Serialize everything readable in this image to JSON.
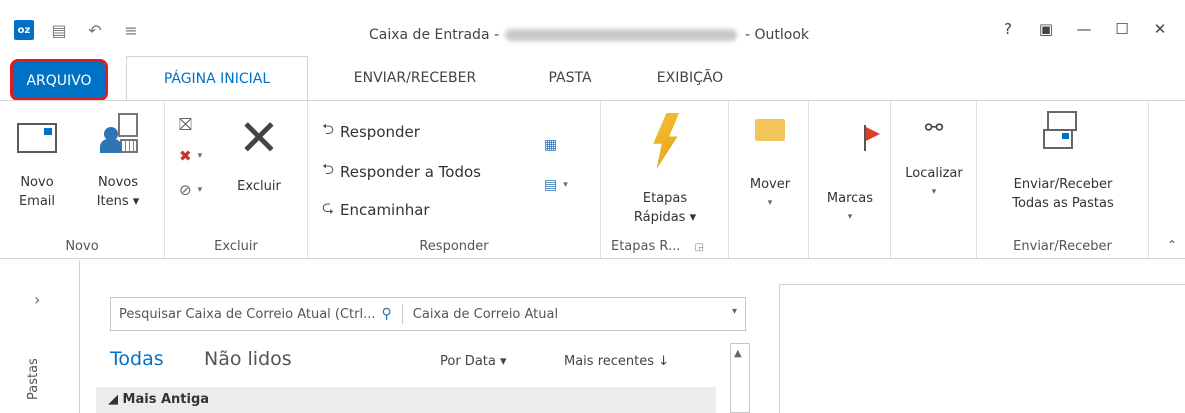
{
  "window": {
    "title_left": "Caixa de Entrada -",
    "title_right": "- Outlook",
    "controls": {
      "help": "?",
      "ribbon_options": "▣",
      "minimize": "—",
      "maximize": "☐",
      "close": "✕"
    },
    "app_icon_text": "oz"
  },
  "tabs": {
    "file": "ARQUIVO",
    "home": "PÁGINA INICIAL",
    "send_receive": "ENVIAR/RECEBER",
    "folder": "PASTA",
    "view": "EXIBIÇÃO"
  },
  "ribbon": {
    "novo": {
      "label": "Novo",
      "new_email": [
        "Novo",
        "Email"
      ],
      "new_items": [
        "Novos",
        "Itens ▾"
      ]
    },
    "excluir": {
      "label": "Excluir",
      "delete": "Excluir"
    },
    "responder": {
      "label": "Responder",
      "reply": "Responder",
      "reply_all": "Responder a Todos",
      "forward": "Encaminhar"
    },
    "etapas": {
      "label": "Etapas R...",
      "quick_steps": [
        "Etapas",
        "Rápidas ▾"
      ]
    },
    "mover": {
      "label": "Mover"
    },
    "marcas": {
      "label": "Marcas"
    },
    "localizar": {
      "label": "Localizar"
    },
    "enviar": {
      "label": "Enviar/Receber",
      "send_all": [
        "Enviar/Receber",
        "Todas as Pastas"
      ]
    }
  },
  "folders_rail": {
    "label": "Pastas"
  },
  "search": {
    "placeholder": "Pesquisar Caixa de Correio Atual (Ctrl...",
    "scope": "Caixa de Correio Atual"
  },
  "filters": {
    "all": "Todas",
    "unread": "Não lidos",
    "by_date": "Por Data ▾",
    "recent": "Mais recentes ↓"
  },
  "list": {
    "group_header": "◢ Mais Antiga"
  },
  "colors": {
    "accent": "#0072c6",
    "highlight": "#e11b22"
  }
}
